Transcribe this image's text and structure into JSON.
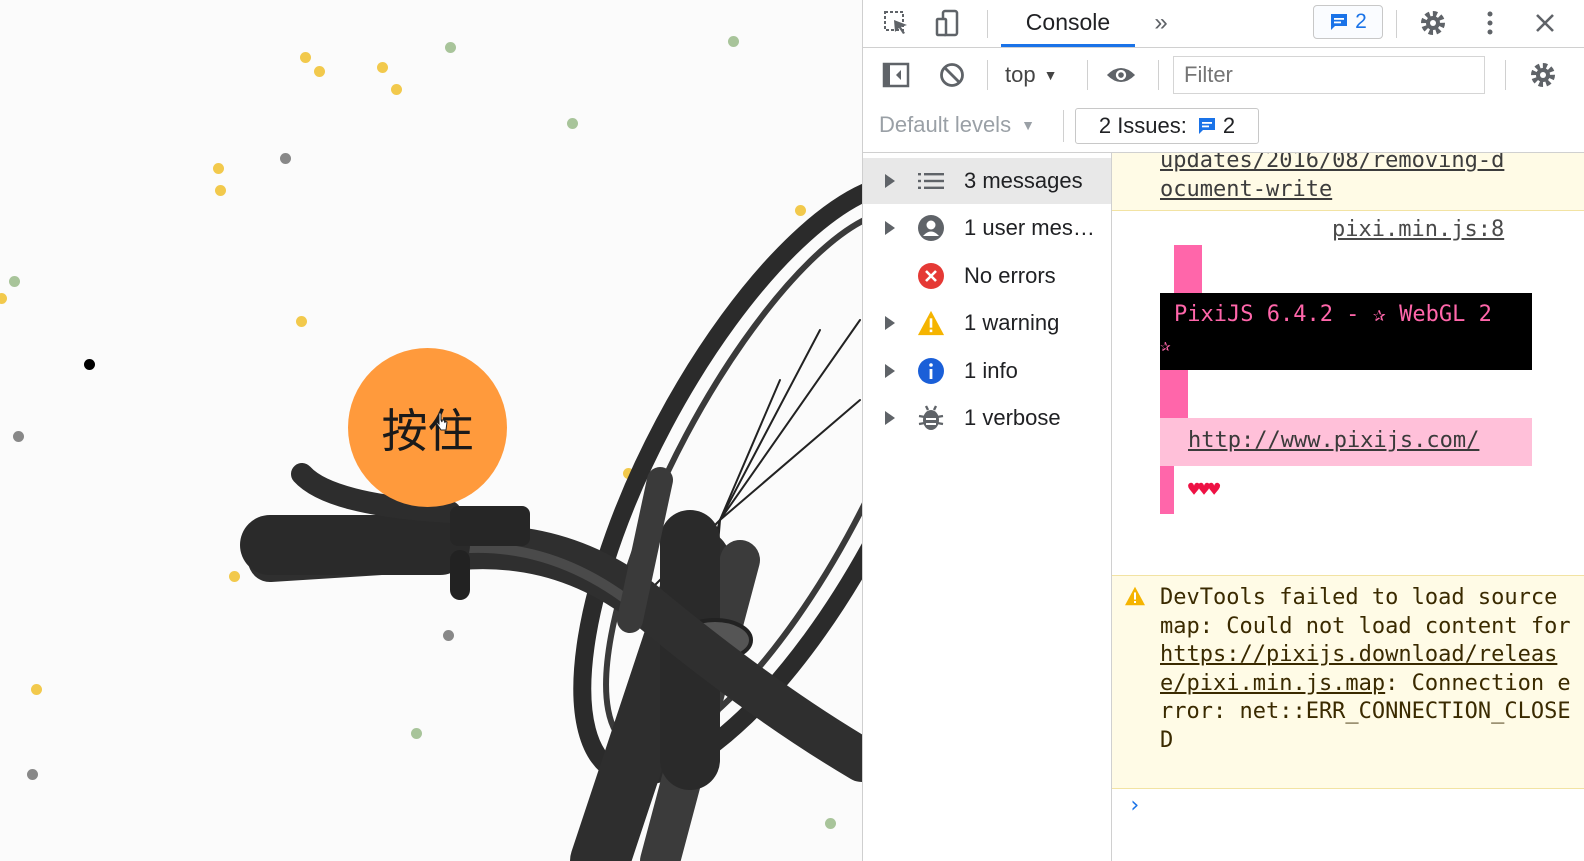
{
  "canvas": {
    "hold_button_label": "按住",
    "button_color": "#ff9a3c"
  },
  "devtools": {
    "tabs": {
      "console_label": "Console",
      "issues_count": "2"
    },
    "toolbar": {
      "context": "top",
      "filter_placeholder": "Filter",
      "default_levels": "Default levels",
      "issues_label": "2 Issues:",
      "issues_count": "2"
    },
    "sidebar": {
      "items": [
        {
          "label": "3 messages",
          "icon": "list-icon"
        },
        {
          "label": "1 user mes…",
          "icon": "user-icon"
        },
        {
          "label": "No errors",
          "icon": "error-icon"
        },
        {
          "label": "1 warning",
          "icon": "warning-icon"
        },
        {
          "label": "1 info",
          "icon": "info-icon"
        },
        {
          "label": "1 verbose",
          "icon": "bug-icon"
        }
      ]
    },
    "console": {
      "top_link_line1": "updates/2016/08/removing-d",
      "top_link_line2": "ocument-write",
      "source_link": "pixi.min.js:8",
      "pixi_line1": "PixiJS 6.4.2 - ✰ WebGL 2",
      "pixi_line2": "✰",
      "pixi_url": "http://www.pixijs.com/",
      "hearts": "♥♥♥",
      "warning_prefix": "DevTools failed to load source map: Could not load content for ",
      "warning_link": "https://pixijs.download/release/pixi.min.js.map",
      "warning_suffix": ": Connection error: net::ERR_CONNECTION_CLOSED",
      "prompt": "›"
    }
  }
}
